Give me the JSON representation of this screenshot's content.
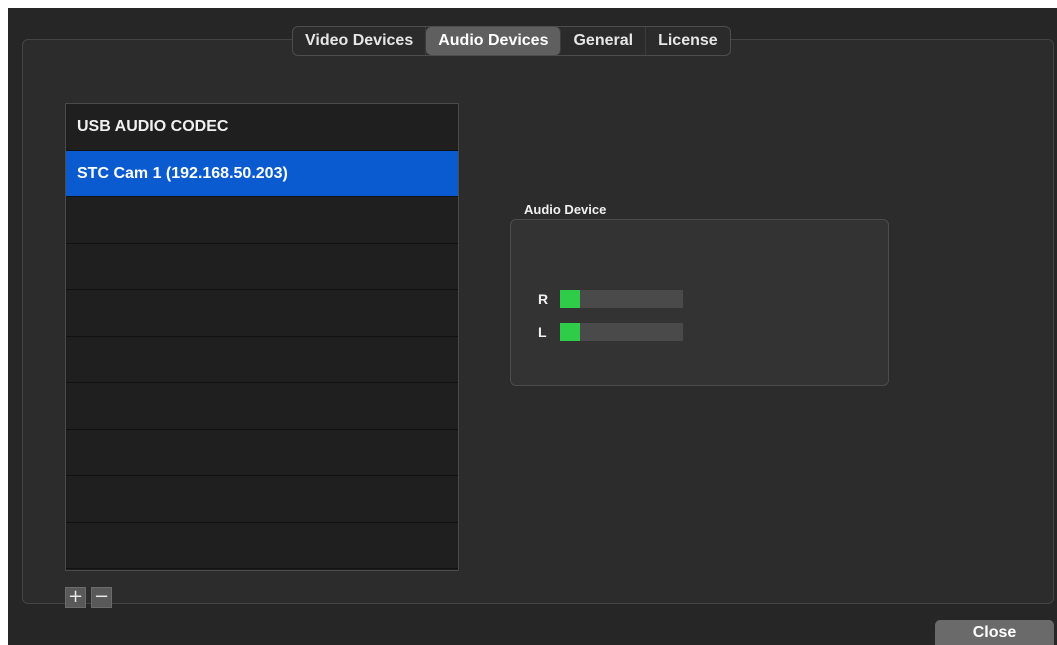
{
  "tabs": [
    {
      "label": "Video Devices",
      "active": false
    },
    {
      "label": "Audio Devices",
      "active": true
    },
    {
      "label": "General",
      "active": false
    },
    {
      "label": "License",
      "active": false
    }
  ],
  "device_list": {
    "items": [
      "USB AUDIO  CODEC",
      "STC Cam 1 (192.168.50.203)"
    ],
    "selected_index": 1
  },
  "list_buttons": {
    "add_label": "+",
    "remove_label": "−"
  },
  "audio_device": {
    "title": "Audio Device",
    "channels": [
      {
        "label": "R",
        "level": 0.16
      },
      {
        "label": "L",
        "level": 0.16
      }
    ]
  },
  "close_label": "Close",
  "colors": {
    "window_background": "#262626",
    "selection": "#0a5bd0",
    "meter_fill": "#2ecc48",
    "meter_track": "#4a4a4a"
  }
}
